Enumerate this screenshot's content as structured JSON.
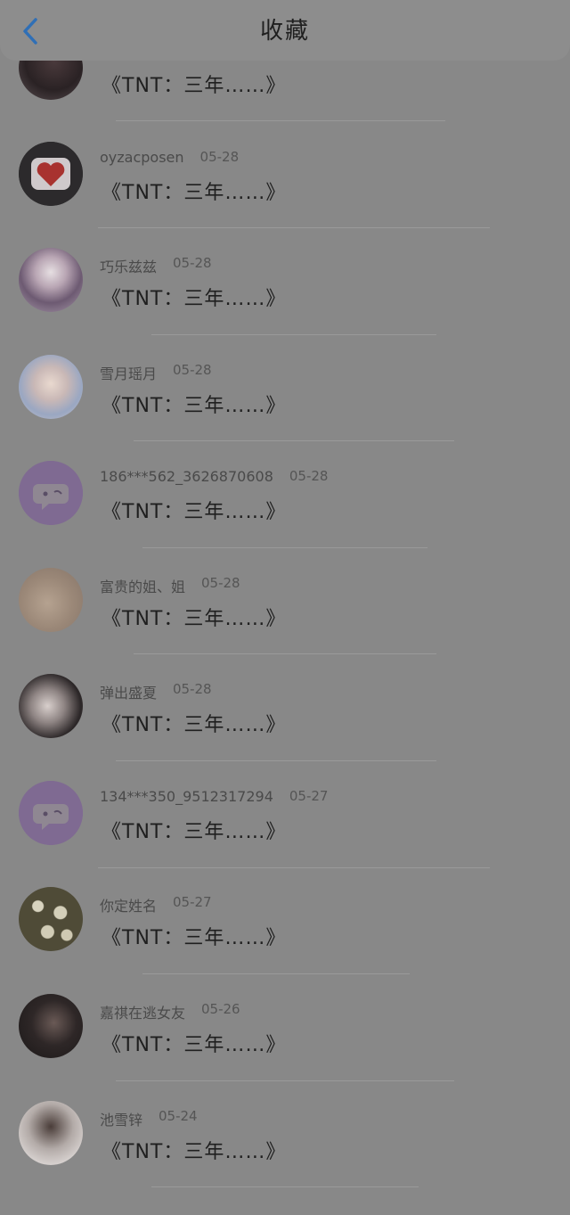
{
  "header": {
    "title": "收藏"
  },
  "colors": {
    "accent": "#2f6fb6",
    "chat_avatar_bg": "#7f6a92"
  },
  "items": [
    {
      "name": "",
      "date": "",
      "title": "《TNT：三年……》",
      "avatar": "photo-dark-figure"
    },
    {
      "name": "oyzacposen",
      "date": "05-28",
      "title": "《TNT：三年……》",
      "avatar": "heart-icon"
    },
    {
      "name": "巧乐兹兹",
      "date": "05-28",
      "title": "《TNT：三年……》",
      "avatar": "anime-girl-dark-hair"
    },
    {
      "name": "雪月瑶月",
      "date": "05-28",
      "title": "《TNT：三年……》",
      "avatar": "anime-girl-light-hair"
    },
    {
      "name": "186***562_3626870608",
      "date": "05-28",
      "title": "《TNT：三年……》",
      "avatar": "chat-bubble-icon"
    },
    {
      "name": "富贵的姐、姐",
      "date": "05-28",
      "title": "《TNT：三年……》",
      "avatar": "photo-beige"
    },
    {
      "name": "弹出盛夏",
      "date": "05-28",
      "title": "《TNT：三年……》",
      "avatar": "photo-girl"
    },
    {
      "name": "134***350_9512317294",
      "date": "05-27",
      "title": "《TNT：三年……》",
      "avatar": "chat-bubble-icon"
    },
    {
      "name": "你定姓名",
      "date": "05-27",
      "title": "《TNT：三年……》",
      "avatar": "photo-daisies"
    },
    {
      "name": "嘉祺在逃女友",
      "date": "05-26",
      "title": "《TNT：三年……》",
      "avatar": "photo-dark-boy"
    },
    {
      "name": "池雪锌",
      "date": "05-24",
      "title": "《TNT：三年……》",
      "avatar": "photo-light-girl"
    }
  ]
}
